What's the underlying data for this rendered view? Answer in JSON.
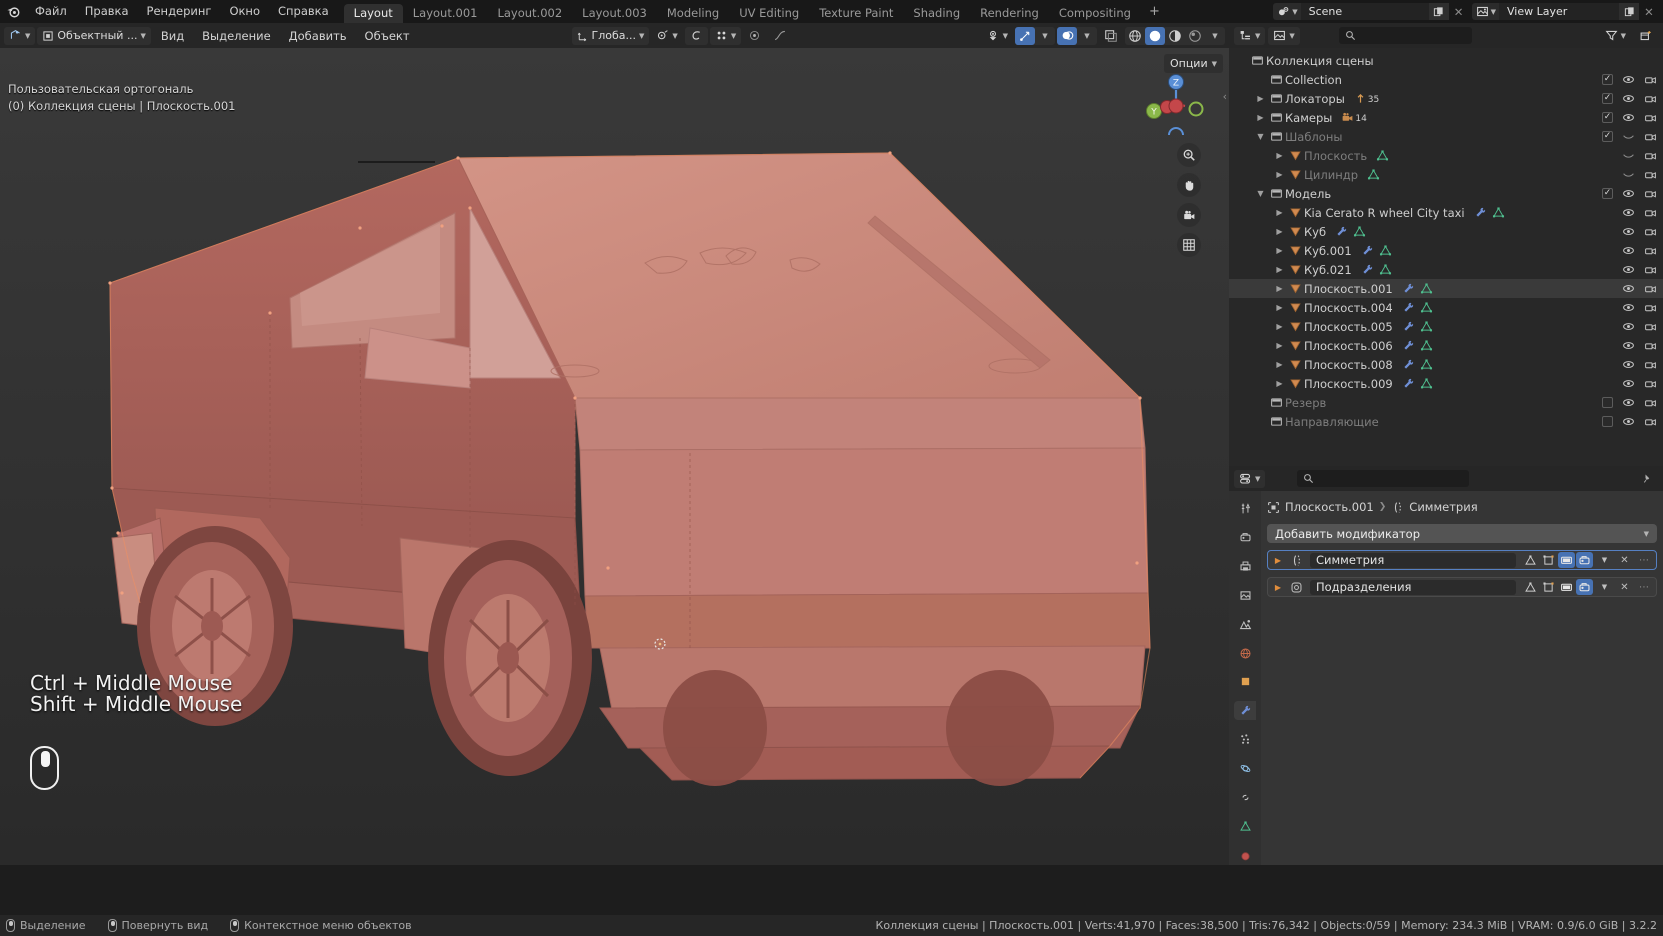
{
  "app": {
    "logo_icon": "blender-logo-icon"
  },
  "topbar": {
    "menus": [
      "Файл",
      "Правка",
      "Рендеринг",
      "Окно",
      "Справка"
    ],
    "workspaces": [
      {
        "label": "Layout",
        "active": true
      },
      {
        "label": "Layout.001",
        "active": false
      },
      {
        "label": "Layout.002",
        "active": false
      },
      {
        "label": "Layout.003",
        "active": false
      },
      {
        "label": "Modeling",
        "active": false
      },
      {
        "label": "UV Editing",
        "active": false
      },
      {
        "label": "Texture Paint",
        "active": false
      },
      {
        "label": "Shading",
        "active": false
      },
      {
        "label": "Rendering",
        "active": false
      },
      {
        "label": "Compositing",
        "active": false
      }
    ],
    "add_workspace_label": "+",
    "scene_name": "Scene",
    "view_layer_name": "View Layer",
    "scene_icon": "scene-icon",
    "view_layer_icon": "view-layer-icon",
    "new_icon": "duplicate-icon",
    "remove_icon": "x-icon"
  },
  "viewport_header": {
    "editor_type_icon": "editor-type-3dview-icon",
    "mode_label": "Объектный ...",
    "mode_icon": "object-mode-icon",
    "menus": [
      "Вид",
      "Выделение",
      "Добавить",
      "Объект"
    ],
    "transform_orientation_label": "Глоба...",
    "transform_orientation_icon": "orientation-global-icon",
    "snap_icon": "snap-magnet-icon",
    "proportional_icon": "proportional-edit-icon",
    "pivot_icon": "pivot-point-icon",
    "visibility_icon": "object-types-visibility-icon",
    "gizmo_icon": "gizmo-icon",
    "overlays_icon": "overlays-icon",
    "xray_icon": "xray-toggle-icon",
    "shading_modes": [
      "wireframe",
      "solid",
      "material-preview",
      "rendered"
    ],
    "shading_active": "solid"
  },
  "viewport": {
    "options_label": "Опции",
    "view_name_line1": "Пользовательская ортогональ",
    "view_name_line2": "(0) Коллекция сцены | Плоскость.001",
    "overlay_hint_line1": "Ctrl + Middle Mouse",
    "overlay_hint_line2": "Shift + Middle Mouse",
    "mouse_hint_icon": "middle-mouse-icon",
    "gizmo_axes": [
      "Z",
      "Y",
      "X"
    ],
    "nav_buttons": [
      "zoom-icon",
      "hand-pan-icon",
      "camera-perspective-icon",
      "grid-ortho-icon"
    ],
    "mesh_color": "#c47d72",
    "mesh_outline_color": "#f09060"
  },
  "outliner": {
    "display_mode_icon": "outliner-display-mode-icon",
    "id_filter_icon": "view-layer-icon",
    "search_placeholder": "",
    "search_value": "",
    "search_icon": "search-icon",
    "filter_icon": "funnel-filter-icon",
    "new_collection_icon": "new-collection-icon",
    "rows": [
      {
        "indent": 0,
        "disclosure": "",
        "icon": "collection-icon",
        "label": "Коллекция сцены",
        "dim": false,
        "extra": [],
        "checkbox": null,
        "eye": false,
        "camera": false
      },
      {
        "indent": 1,
        "disclosure": "",
        "icon": "collection-icon",
        "label": "Collection",
        "dim": false,
        "extra": [],
        "checkbox": true,
        "eye": true,
        "camera": true
      },
      {
        "indent": 1,
        "disclosure": "▶",
        "icon": "collection-icon",
        "label": "Локаторы",
        "dim": false,
        "extra": [
          "empty-axes-icon"
        ],
        "extra_count": "35",
        "checkbox": true,
        "eye": true,
        "camera": true
      },
      {
        "indent": 1,
        "disclosure": "▶",
        "icon": "collection-icon",
        "label": "Камеры",
        "dim": false,
        "extra": [
          "camera-data-icon"
        ],
        "extra_count": "14",
        "checkbox": true,
        "eye": true,
        "camera": true
      },
      {
        "indent": 1,
        "disclosure": "▼",
        "icon": "collection-icon",
        "label": "Шаблоны",
        "dim": true,
        "extra": [],
        "checkbox": true,
        "eye": "hidden",
        "camera": true
      },
      {
        "indent": 2,
        "disclosure": "▶",
        "icon": "mesh-object-icon",
        "label": "Плоскость",
        "dim": true,
        "extra": [
          "mesh-data-icon"
        ],
        "checkbox": null,
        "eye": "hidden",
        "camera": true
      },
      {
        "indent": 2,
        "disclosure": "▶",
        "icon": "mesh-object-icon",
        "label": "Цилиндр",
        "dim": true,
        "extra": [
          "mesh-data-icon"
        ],
        "checkbox": null,
        "eye": "hidden",
        "camera": true
      },
      {
        "indent": 1,
        "disclosure": "▼",
        "icon": "collection-icon",
        "label": "Модель",
        "dim": false,
        "extra": [],
        "checkbox": true,
        "eye": true,
        "camera": true
      },
      {
        "indent": 2,
        "disclosure": "▶",
        "icon": "mesh-object-icon",
        "label": "Kia Cerato R wheel City taxi",
        "dim": false,
        "extra": [
          "modifier-icon",
          "mesh-data-icon"
        ],
        "checkbox": null,
        "eye": true,
        "camera": true
      },
      {
        "indent": 2,
        "disclosure": "▶",
        "icon": "mesh-object-icon",
        "label": "Куб",
        "dim": false,
        "extra": [
          "modifier-icon",
          "mesh-data-icon"
        ],
        "checkbox": null,
        "eye": true,
        "camera": true
      },
      {
        "indent": 2,
        "disclosure": "▶",
        "icon": "mesh-object-icon",
        "label": "Куб.001",
        "dim": false,
        "extra": [
          "modifier-icon",
          "mesh-data-icon"
        ],
        "checkbox": null,
        "eye": true,
        "camera": true
      },
      {
        "indent": 2,
        "disclosure": "▶",
        "icon": "mesh-object-icon",
        "label": "Куб.021",
        "dim": false,
        "extra": [
          "modifier-icon",
          "mesh-data-icon"
        ],
        "checkbox": null,
        "eye": true,
        "camera": true
      },
      {
        "indent": 2,
        "disclosure": "▶",
        "icon": "mesh-object-icon",
        "label": "Плоскость.001",
        "dim": false,
        "selected": true,
        "extra": [
          "modifier-icon",
          "mesh-data-icon"
        ],
        "checkbox": null,
        "eye": true,
        "camera": true
      },
      {
        "indent": 2,
        "disclosure": "▶",
        "icon": "mesh-object-icon",
        "label": "Плоскость.004",
        "dim": false,
        "extra": [
          "modifier-icon",
          "mesh-data-icon"
        ],
        "checkbox": null,
        "eye": true,
        "camera": true
      },
      {
        "indent": 2,
        "disclosure": "▶",
        "icon": "mesh-object-icon",
        "label": "Плоскость.005",
        "dim": false,
        "extra": [
          "modifier-icon",
          "mesh-data-icon"
        ],
        "checkbox": null,
        "eye": true,
        "camera": true
      },
      {
        "indent": 2,
        "disclosure": "▶",
        "icon": "mesh-object-icon",
        "label": "Плоскость.006",
        "dim": false,
        "extra": [
          "modifier-icon",
          "mesh-data-icon"
        ],
        "checkbox": null,
        "eye": true,
        "camera": true
      },
      {
        "indent": 2,
        "disclosure": "▶",
        "icon": "mesh-object-icon",
        "label": "Плоскость.008",
        "dim": false,
        "extra": [
          "modifier-icon",
          "mesh-data-icon"
        ],
        "checkbox": null,
        "eye": true,
        "camera": true
      },
      {
        "indent": 2,
        "disclosure": "▶",
        "icon": "mesh-object-icon",
        "label": "Плоскость.009",
        "dim": false,
        "extra": [
          "modifier-icon",
          "mesh-data-icon"
        ],
        "checkbox": null,
        "eye": true,
        "camera": true
      },
      {
        "indent": 1,
        "disclosure": "",
        "icon": "collection-icon",
        "label": "Резерв",
        "dim": true,
        "extra": [],
        "checkbox": false,
        "eye": true,
        "camera": true
      },
      {
        "indent": 1,
        "disclosure": "",
        "icon": "collection-icon",
        "label": "Направляющие",
        "dim": true,
        "extra": [],
        "checkbox": false,
        "eye": true,
        "camera": true
      }
    ]
  },
  "properties": {
    "editor_type_icon": "editor-type-properties-icon",
    "search_placeholder": "",
    "search_value": "",
    "search_icon": "search-icon",
    "breadcrumb": {
      "object_icon": "object-icon",
      "object_name": "Плоскость.001",
      "separator": "❯",
      "modifier_icon": "modifier-icon",
      "modifier_name": "Симметрия"
    },
    "add_modifier_label": "Добавить модификатор",
    "tabs": [
      {
        "icon": "tool-icon",
        "active": false
      },
      {
        "icon": "render-icon",
        "active": false
      },
      {
        "icon": "output-printer-icon",
        "active": false
      },
      {
        "icon": "view-layer-props-icon",
        "active": false
      },
      {
        "icon": "scene-props-icon",
        "active": false
      },
      {
        "icon": "world-props-icon",
        "active": false
      },
      {
        "icon": "object-props-icon",
        "active": false
      },
      {
        "icon": "modifier-wrench-icon",
        "active": true
      },
      {
        "icon": "particles-icon",
        "active": false
      },
      {
        "icon": "physics-icon",
        "active": false
      },
      {
        "icon": "constraints-icon",
        "active": false
      },
      {
        "icon": "mesh-data-props-icon",
        "active": false
      },
      {
        "icon": "material-props-icon",
        "active": false
      }
    ],
    "modifiers": [
      {
        "name": "Симметрия",
        "icon": "modifier-mirror-icon",
        "selected": true,
        "disclosure": "▶",
        "toggles": [
          {
            "icon": "on-cage-icon",
            "on": false
          },
          {
            "icon": "edit-mode-display-icon",
            "on": false
          },
          {
            "icon": "realtime-display-icon",
            "on": true
          },
          {
            "icon": "render-display-icon",
            "on": true
          }
        ],
        "dropdown_icon": "chevron-down-icon",
        "close_icon": "x-icon",
        "extras_icon": "dots-icon"
      },
      {
        "name": "Подразделения",
        "icon": "modifier-subsurf-icon",
        "selected": false,
        "disclosure": "▶",
        "toggles": [
          {
            "icon": "on-cage-icon",
            "on": false
          },
          {
            "icon": "edit-mode-display-icon",
            "on": false
          },
          {
            "icon": "realtime-display-icon",
            "on": false
          },
          {
            "icon": "render-display-icon",
            "on": true
          }
        ],
        "dropdown_icon": "chevron-down-icon",
        "close_icon": "x-icon",
        "extras_icon": "dots-icon"
      }
    ]
  },
  "statusbar": {
    "keymap": [
      {
        "icon": "mouse-left-icon",
        "label": "Выделение"
      },
      {
        "icon": "mouse-middle-icon",
        "label": "Повернуть вид"
      },
      {
        "icon": "mouse-right-icon",
        "label": "Контекстное меню объектов"
      }
    ],
    "stats": "Коллекция сцены | Плоскость.001 | Verts:41,970 | Faces:38,500 | Tris:76,342 | Objects:0/59 | Memory: 234.3 MiB | VRAM: 0.9/6.0 GiB | 3.2.2"
  }
}
